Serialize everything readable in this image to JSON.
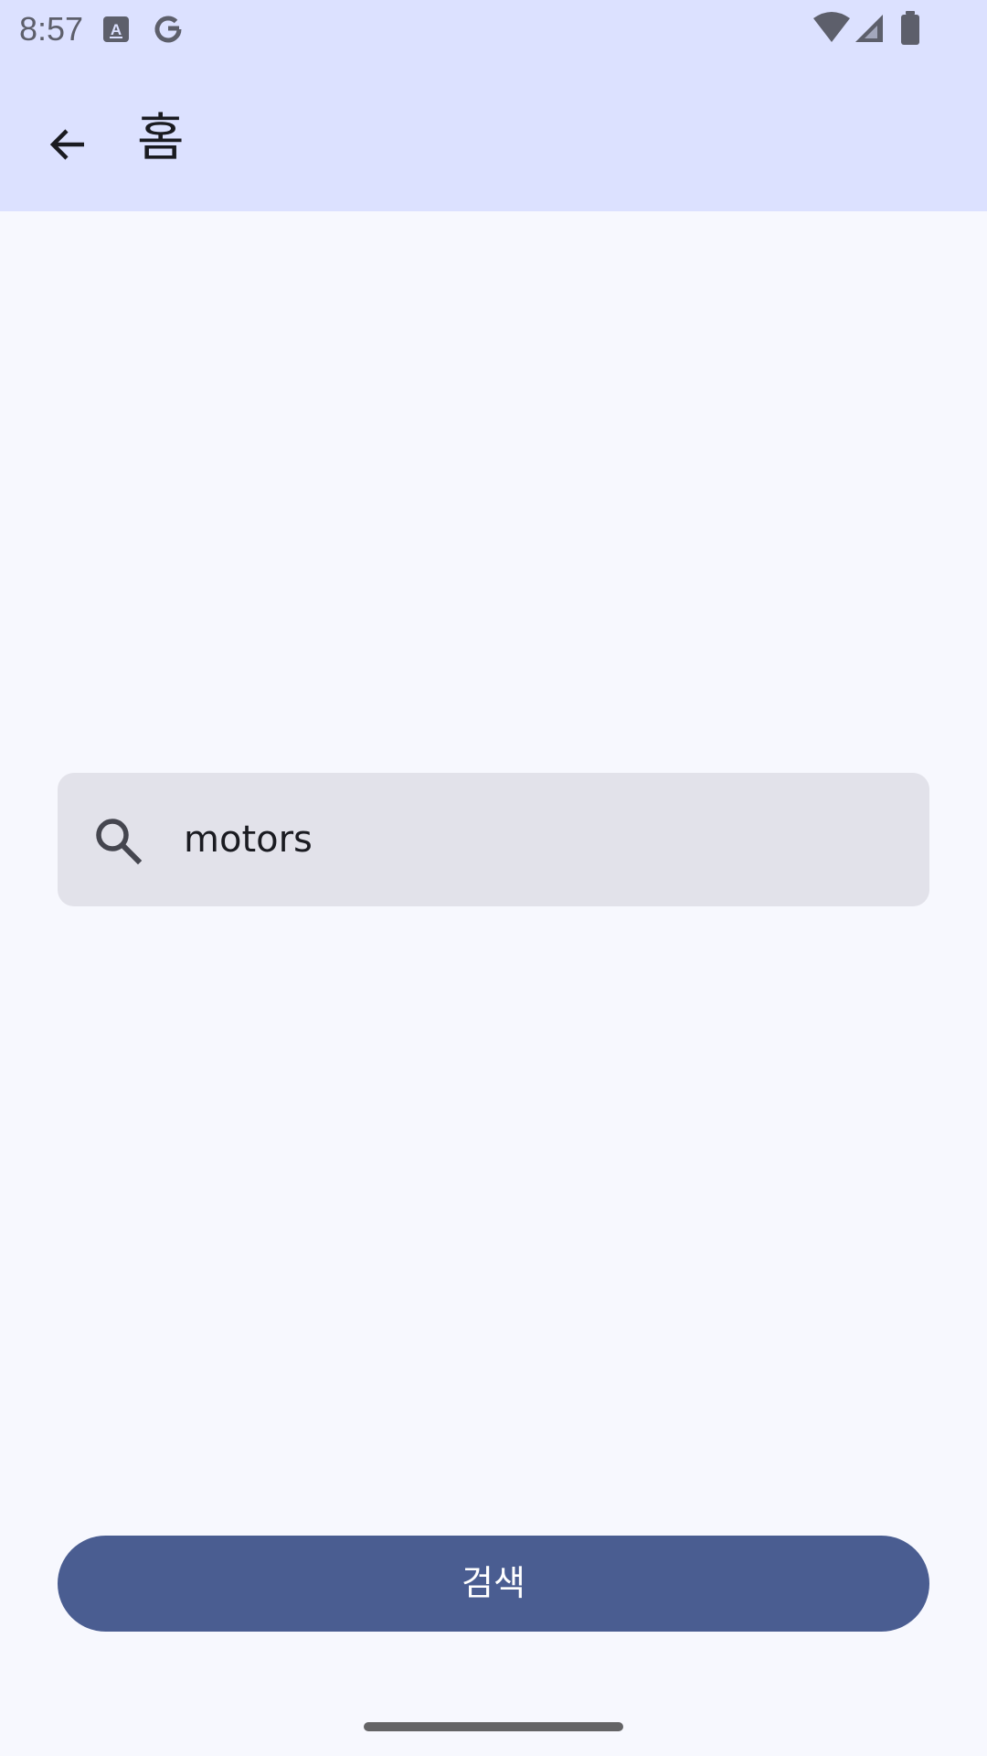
{
  "status_bar": {
    "time": "8:57",
    "icons": [
      "font-app-icon",
      "google-icon",
      "wifi-icon",
      "cell-signal-icon",
      "battery-icon"
    ]
  },
  "app_bar": {
    "back_icon": "arrow-back-icon",
    "title": "홈"
  },
  "search": {
    "icon": "search-icon",
    "value": "motors"
  },
  "search_button": {
    "label": "검색"
  },
  "colors": {
    "app_bar_bg": "#dce1ff",
    "page_bg": "#f7f8fe",
    "field_bg": "#e2e2ea",
    "button_bg": "#4a5d91",
    "button_text": "#ffffff",
    "text": "#1a1b21"
  }
}
